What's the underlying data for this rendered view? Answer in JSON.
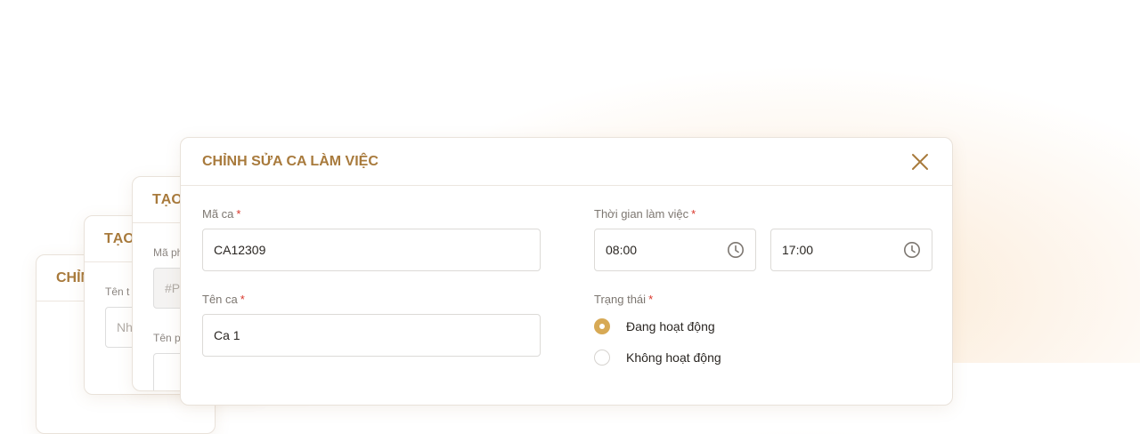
{
  "back_cards": [
    {
      "title": "CHỈNH",
      "labels": [],
      "inputs": []
    },
    {
      "title": "TẠO",
      "labels": [
        "Tên t"
      ],
      "inputs": [
        "Nhậ"
      ]
    },
    {
      "title": "TẠO",
      "labels": [
        "Mã ph",
        "Tên p"
      ],
      "inputs": [
        "#P",
        ""
      ]
    }
  ],
  "dialog": {
    "title": "CHỈNH SỬA CA LÀM VIỆC",
    "shift_code": {
      "label": "Mã ca",
      "required": "*",
      "value": "CA12309"
    },
    "shift_name": {
      "label": "Tên ca",
      "required": "*",
      "value": "Ca 1"
    },
    "work_time": {
      "label": "Thời gian làm việc",
      "required": "*",
      "start": "08:00",
      "end": "17:00"
    },
    "status": {
      "label": "Trạng thái",
      "required": "*",
      "options": [
        {
          "label": "Đang hoạt động",
          "selected": true
        },
        {
          "label": "Không hoạt động",
          "selected": false
        }
      ]
    }
  },
  "colors": {
    "accent": "#a87a3c",
    "radio_selected": "#d7a955",
    "required": "#d9362a"
  },
  "icons": {
    "close": "close-icon",
    "clock": "clock-icon"
  }
}
